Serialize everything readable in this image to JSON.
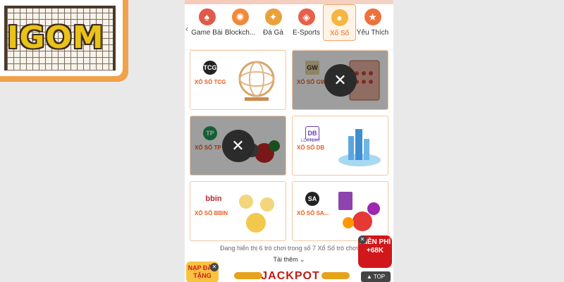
{
  "logo": {
    "text": "IGOM"
  },
  "tabs": [
    {
      "label": "Game Bài",
      "icon": "cards-icon",
      "color": "#e05a4a"
    },
    {
      "label": "Blockch...",
      "icon": "blockchain-icon",
      "color": "#f08a3a"
    },
    {
      "label": "Đá Gà",
      "icon": "rooster-icon",
      "color": "#e8a23a"
    },
    {
      "label": "E-Sports",
      "icon": "gamepad-icon",
      "color": "#e6604a"
    },
    {
      "label": "Xổ Số",
      "icon": "lottery-balls-icon",
      "color": "#f5b642",
      "active": true
    },
    {
      "label": "Yêu Thích",
      "icon": "star-icon",
      "color": "#f0703a"
    }
  ],
  "games": [
    {
      "name": "XỔ SỐ TCG",
      "logo": "TCG",
      "maintenance": false
    },
    {
      "name": "XỔ SỐ GW",
      "logo": "GW",
      "maintenance": true
    },
    {
      "name": "XỔ SỐ TP",
      "logo": "TP",
      "maintenance": true
    },
    {
      "name": "XỔ SỐ DB",
      "logo": "DB",
      "logo_sub": "LOTTERY",
      "maintenance": false
    },
    {
      "name": "XỔ SỐ BBIN",
      "logo": "bbin",
      "maintenance": false
    },
    {
      "name": "XỔ SỐ SA...",
      "logo": "SA",
      "maintenance": false
    }
  ],
  "footer": {
    "count_text": "Đang hiển thị 6 trò chơi trong số 7 Xổ Số trò chơi",
    "load_more": "Tải thêm ⌄",
    "jackpot": "JACKPOT"
  },
  "promo_left": {
    "text": "NẠP ĐẦU TẶNG"
  },
  "promo_right": {
    "text": "MIỄN PHÍ +68K"
  },
  "top_button": "▲ TOP"
}
